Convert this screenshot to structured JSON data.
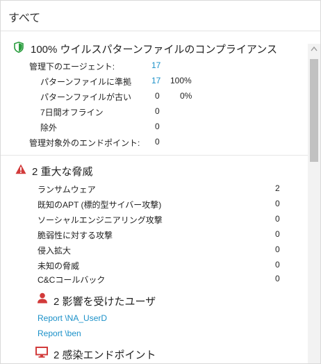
{
  "header": {
    "title": "すべて"
  },
  "compliance": {
    "title": "100%  ウイルスパターンファイルのコンプライアンス",
    "icon": "shield-check-icon",
    "icon_color": "#2a9d3e",
    "rows": [
      {
        "label": "管理下のエージェント:",
        "value": "17",
        "percent": ""
      },
      {
        "label": "パターンファイルに準拠",
        "value": "17",
        "percent": "100%"
      },
      {
        "label": "パターンファイルが古い",
        "value": "0",
        "percent": "0%"
      },
      {
        "label": "7日間オフライン",
        "value": "0",
        "percent": ""
      },
      {
        "label": "除外",
        "value": "0",
        "percent": ""
      },
      {
        "label": "管理対象外のエンドポイント:",
        "value": "0",
        "percent": ""
      }
    ]
  },
  "threats": {
    "title": "2  重大な脅威",
    "icon": "warning-triangle-icon",
    "icon_color": "#d23b3b",
    "rows": [
      {
        "label": "ランサムウェア",
        "value": "2"
      },
      {
        "label": "既知のAPT (標的型サイバー攻撃)",
        "value": "0"
      },
      {
        "label": "ソーシャルエンジニアリング攻撃",
        "value": "0"
      },
      {
        "label": "脆弱性に対する攻撃",
        "value": "0"
      },
      {
        "label": "侵入拡大",
        "value": "0"
      },
      {
        "label": "未知の脅威",
        "value": "0"
      },
      {
        "label": "C&Cコールバック",
        "value": "0"
      }
    ]
  },
  "affected_users": {
    "title": "2  影響を受けたユーザ",
    "icon": "user-icon",
    "icon_color": "#d23b3b",
    "items": [
      "Report \\NA_UserD",
      "Report \\ben"
    ]
  },
  "infected_endpoints": {
    "title": "2  感染エンドポイント",
    "icon": "monitor-icon",
    "icon_color": "#d23b3b"
  },
  "colors": {
    "link": "#1a90c8",
    "accent_blue_value": "#1a90c8"
  }
}
